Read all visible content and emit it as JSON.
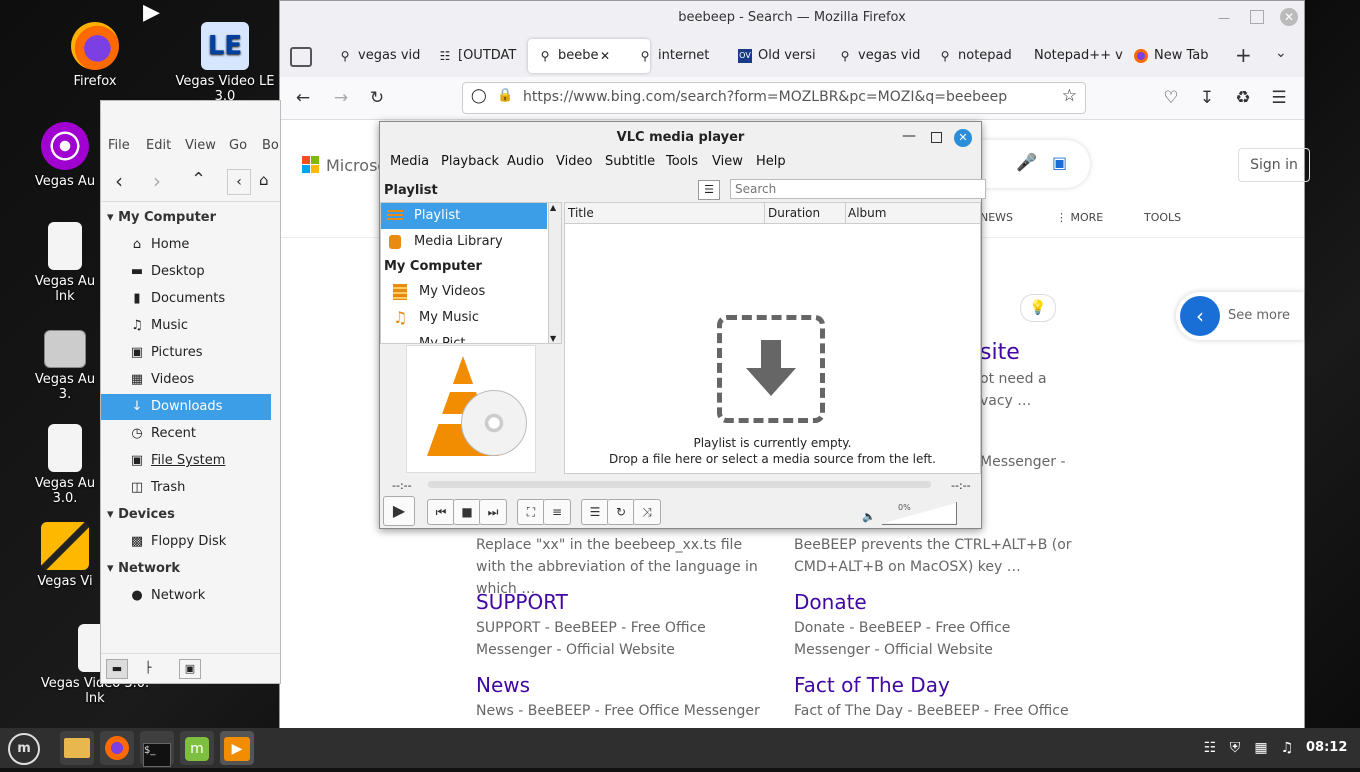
{
  "desktop": {
    "icons": [
      {
        "label": "Firefox"
      },
      {
        "label": "Vegas Video LE 3.0"
      },
      {
        "label": "Vegas Au"
      },
      {
        "label": "Vegas Au lnk"
      },
      {
        "label": "Vegas Au 3."
      },
      {
        "label": "Vegas Au 3.0."
      },
      {
        "label": "Vegas Vi"
      },
      {
        "label": "Vegas Video 3.0. lnk"
      }
    ]
  },
  "firefox": {
    "title": "beebeep - Search — Mozilla Firefox",
    "tabs": [
      {
        "label": "vegas vid",
        "icon": "search-icon"
      },
      {
        "label": "[OUTDAT",
        "icon": "page-icon"
      },
      {
        "label": "beebe",
        "icon": "search-icon",
        "active": true
      },
      {
        "label": "internet",
        "icon": "search-icon"
      },
      {
        "label": "Old versi",
        "icon": "ov-icon"
      },
      {
        "label": "vegas vid",
        "icon": "search-icon"
      },
      {
        "label": "notepad",
        "icon": "search-icon"
      },
      {
        "label": "Notepad++ v",
        "icon": ""
      },
      {
        "label": "New Tab",
        "icon": "firefox-icon"
      }
    ],
    "url": "https://www.bing.com/search?form=MOZLBR&pc=MOZI&q=beebeep"
  },
  "bing": {
    "logo": "Microsoft",
    "sign_in": "Sign in",
    "nav": {
      "news": "NEWS",
      "more": "MORE",
      "tools": "TOOLS"
    },
    "see_more": "See more",
    "partial_title": "site",
    "partial_snippet_1": "ot need a",
    "partial_snippet_2": "vacy …",
    "partial_snippet_3": "Messenger -",
    "results_left": [
      {
        "snippet": "Replace \"xx\" in the beebeep_xx.ts file with the abbreviation of the language in which …"
      },
      {
        "title": "SUPPORT",
        "snippet": "SUPPORT - BeeBEEP - Free Office Messenger - Official Website"
      },
      {
        "title": "News",
        "snippet": "News - BeeBEEP - Free Office Messenger -"
      }
    ],
    "results_right": [
      {
        "snippet": "BeeBEEP prevents the CTRL+ALT+B (or CMD+ALT+B on MacOSX) key …"
      },
      {
        "title": "Donate",
        "snippet": "Donate - BeeBEEP - Free Office Messenger - Official Website"
      },
      {
        "title": "Fact of The Day",
        "snippet": "Fact of The Day - BeeBEEP - Free Office"
      }
    ]
  },
  "filemanager": {
    "menu": [
      "File",
      "Edit",
      "View",
      "Go",
      "Bo"
    ],
    "sections": {
      "my_computer": "My Computer",
      "devices": "Devices",
      "network": "Network"
    },
    "places": [
      {
        "label": "Home",
        "icon": "home-icon"
      },
      {
        "label": "Desktop",
        "icon": "desktop-icon"
      },
      {
        "label": "Documents",
        "icon": "documents-icon"
      },
      {
        "label": "Music",
        "icon": "music-icon"
      },
      {
        "label": "Pictures",
        "icon": "pictures-icon"
      },
      {
        "label": "Videos",
        "icon": "videos-icon"
      },
      {
        "label": "Downloads",
        "icon": "downloads-icon",
        "selected": true
      },
      {
        "label": "Recent",
        "icon": "recent-icon"
      },
      {
        "label": "File System",
        "icon": "filesystem-icon"
      },
      {
        "label": "Trash",
        "icon": "trash-icon"
      }
    ],
    "devices": [
      {
        "label": "Floppy Disk"
      }
    ],
    "network": [
      {
        "label": "Network"
      }
    ]
  },
  "vlc": {
    "title": "VLC media player",
    "menu": [
      "Media",
      "Playback",
      "Audio",
      "Video",
      "Subtitle",
      "Tools",
      "View",
      "Help"
    ],
    "playlist_label": "Playlist",
    "search_placeholder": "Search",
    "side": {
      "playlist": "Playlist",
      "media_library": "Media Library",
      "my_computer": "My Computer",
      "my_videos": "My Videos",
      "my_music": "My Music",
      "my_pictures": "My Pict"
    },
    "columns": [
      "Title",
      "Duration",
      "Album"
    ],
    "empty_line1": "Playlist is currently empty.",
    "empty_line2": "Drop a file here or select a media source from the left.",
    "time_left": "--:--",
    "time_right": "--:--",
    "volume": "0%"
  },
  "taskbar": {
    "clock": "08:12"
  }
}
